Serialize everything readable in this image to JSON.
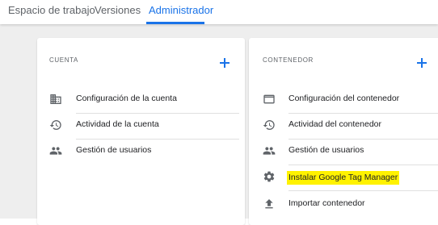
{
  "nav": {
    "tabs": [
      {
        "label": "Espacio de trabajo"
      },
      {
        "label": "Versiones"
      },
      {
        "label": "Administrador"
      }
    ]
  },
  "account": {
    "title": "CUENTA",
    "items": [
      {
        "label": "Configuración de la cuenta",
        "icon": "building-icon"
      },
      {
        "label": "Actividad de la cuenta",
        "icon": "history-icon"
      },
      {
        "label": "Gestión de usuarios",
        "icon": "people-icon"
      }
    ]
  },
  "container": {
    "title": "CONTENEDOR",
    "items": [
      {
        "label": "Configuración del contenedor",
        "icon": "window-icon"
      },
      {
        "label": "Actividad del contenedor",
        "icon": "history-icon"
      },
      {
        "label": "Gestión de usuarios",
        "icon": "people-icon"
      },
      {
        "label": "Instalar Google Tag Manager",
        "icon": "gear-icon",
        "highlighted": true
      },
      {
        "label": "Importar contenedor",
        "icon": "upload-icon"
      }
    ]
  },
  "colors": {
    "accent": "#1a73e8",
    "highlight": "#fff200"
  }
}
